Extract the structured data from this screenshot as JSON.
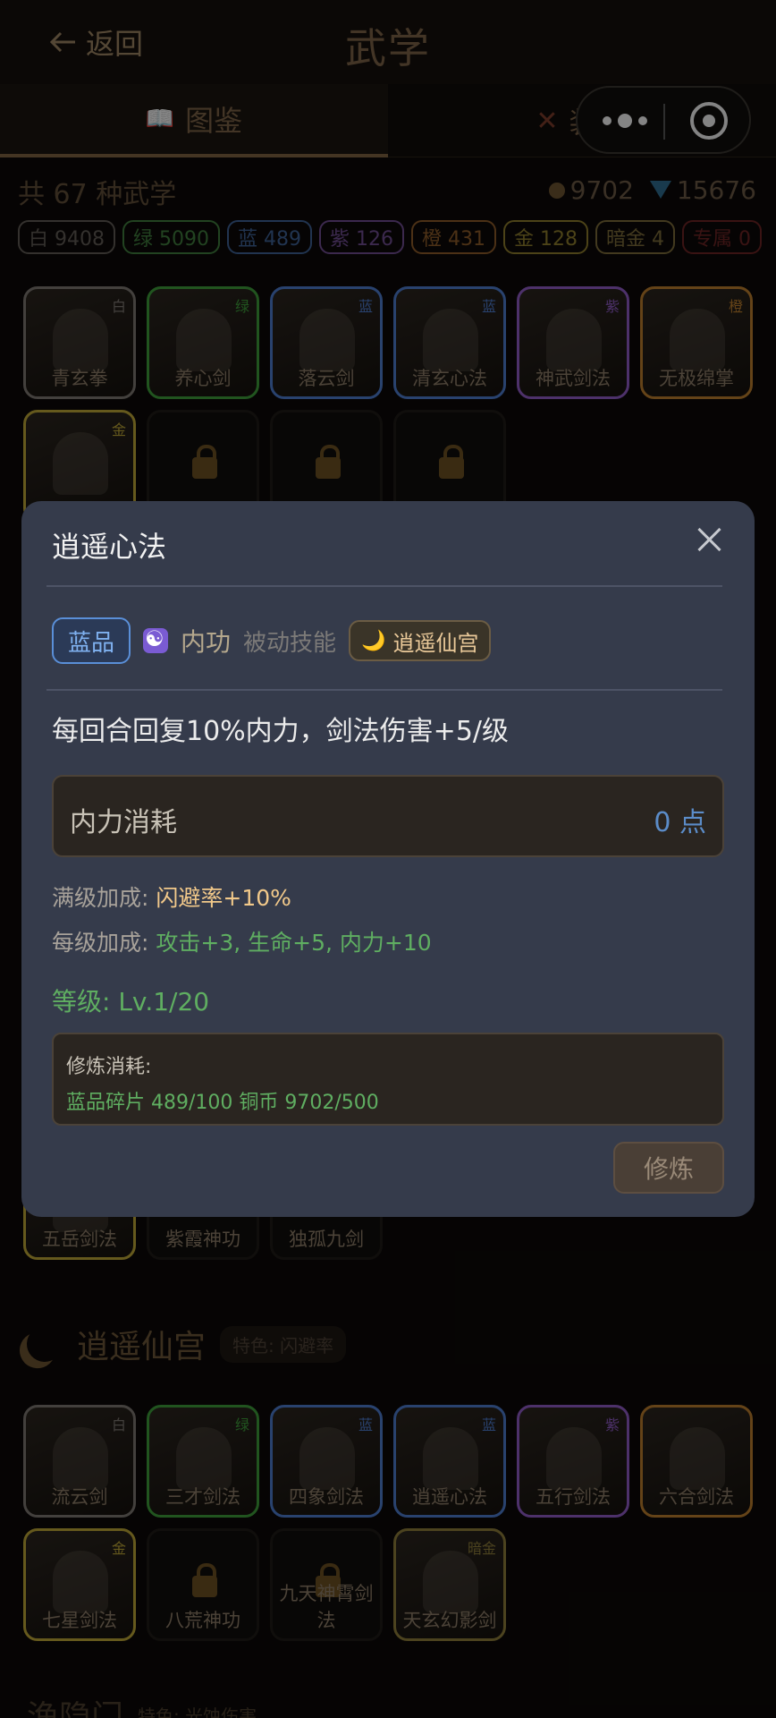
{
  "header": {
    "back_label": "返回",
    "title": "武学"
  },
  "tabs": [
    {
      "label": "图鉴"
    },
    {
      "label": "装备"
    }
  ],
  "summary": {
    "text": "共 67 种武学",
    "coins": "9702",
    "gems": "15676"
  },
  "rarities": [
    {
      "label": "白 9408",
      "color": "#5f5a54"
    },
    {
      "label": "绿 5090",
      "color": "#3f7a3c"
    },
    {
      "label": "蓝 489",
      "color": "#3d5f92"
    },
    {
      "label": "紫 126",
      "color": "#6d4c8f"
    },
    {
      "label": "橙 431",
      "color": "#8a5a28"
    },
    {
      "label": "金 128",
      "color": "#8a7a2c"
    },
    {
      "label": "暗金 4",
      "color": "#7a6a3a"
    },
    {
      "label": "专属 0",
      "color": "#6a2424"
    }
  ],
  "grid1": [
    {
      "name": "青玄拳",
      "tag": "白",
      "color": "#7b7570"
    },
    {
      "name": "养心剑",
      "tag": "绿",
      "color": "#3c9a3a"
    },
    {
      "name": "落云剑",
      "tag": "蓝",
      "color": "#4b78c8"
    },
    {
      "name": "清玄心法",
      "tag": "蓝",
      "color": "#4b78c8"
    },
    {
      "name": "神武剑法",
      "tag": "紫",
      "color": "#8c5ac2"
    },
    {
      "name": "无极绵掌",
      "tag": "橙",
      "color": "#b67a2c"
    },
    {
      "name": "",
      "tag": "金",
      "color": "#b9a235"
    },
    {
      "name": "",
      "tag": "",
      "color": "#1e1a16",
      "locked": true
    },
    {
      "name": "",
      "tag": "",
      "color": "#1e1a16",
      "locked": true
    },
    {
      "name": "",
      "tag": "",
      "color": "#1e1a16",
      "locked": true
    }
  ],
  "grid_partial": [
    {
      "name": "五岳剑法",
      "tag": "",
      "color": "#b9a235"
    },
    {
      "name": "紫霞神功",
      "tag": "",
      "color": "#1e1a16",
      "locked": true
    },
    {
      "name": "独孤九剑",
      "tag": "",
      "color": "#1e1a16",
      "locked": true
    }
  ],
  "sect": {
    "name": "逍遥仙宫",
    "feature": "特色: 闪避率"
  },
  "grid2": [
    {
      "name": "流云剑",
      "tag": "白",
      "color": "#7b7570"
    },
    {
      "name": "三才剑法",
      "tag": "绿",
      "color": "#3c9a3a"
    },
    {
      "name": "四象剑法",
      "tag": "蓝",
      "color": "#4b78c8"
    },
    {
      "name": "逍遥心法",
      "tag": "蓝",
      "color": "#4b78c8"
    },
    {
      "name": "五行剑法",
      "tag": "紫",
      "color": "#8c5ac2"
    },
    {
      "name": "六合剑法",
      "tag": "",
      "color": "#b67a2c"
    },
    {
      "name": "七星剑法",
      "tag": "金",
      "color": "#b9a235"
    },
    {
      "name": "八荒神功",
      "tag": "",
      "color": "#1e1a16",
      "locked": true
    },
    {
      "name": "九天神霄剑法",
      "tag": "",
      "color": "#1e1a16",
      "locked": true
    },
    {
      "name": "天玄幻影剑",
      "tag": "暗金",
      "color": "#8a7a3a"
    }
  ],
  "sect2": {
    "name": "渔隐门",
    "feature": "特色: 光蚀伤害"
  },
  "modal": {
    "title": "逍遥心法",
    "rarity": "蓝品",
    "type": "内功",
    "kind": "被动技能",
    "sect": "逍遥仙宫",
    "description": "每回合回复10%内力，剑法伤害+5/级",
    "cost_label": "内力消耗",
    "cost_value": "0 点",
    "max_bonus_label": "满级加成:",
    "max_bonus_value": "闪避率+10%",
    "per_level_label": "每级加成:",
    "per_level_value": "攻击+3, 生命+5, 内力+10",
    "level": "等级: Lv.1/20",
    "train_title": "修炼消耗:",
    "train_cost": "蓝品碎片 489/100   铜币 9702/500",
    "train_button": "修炼"
  }
}
